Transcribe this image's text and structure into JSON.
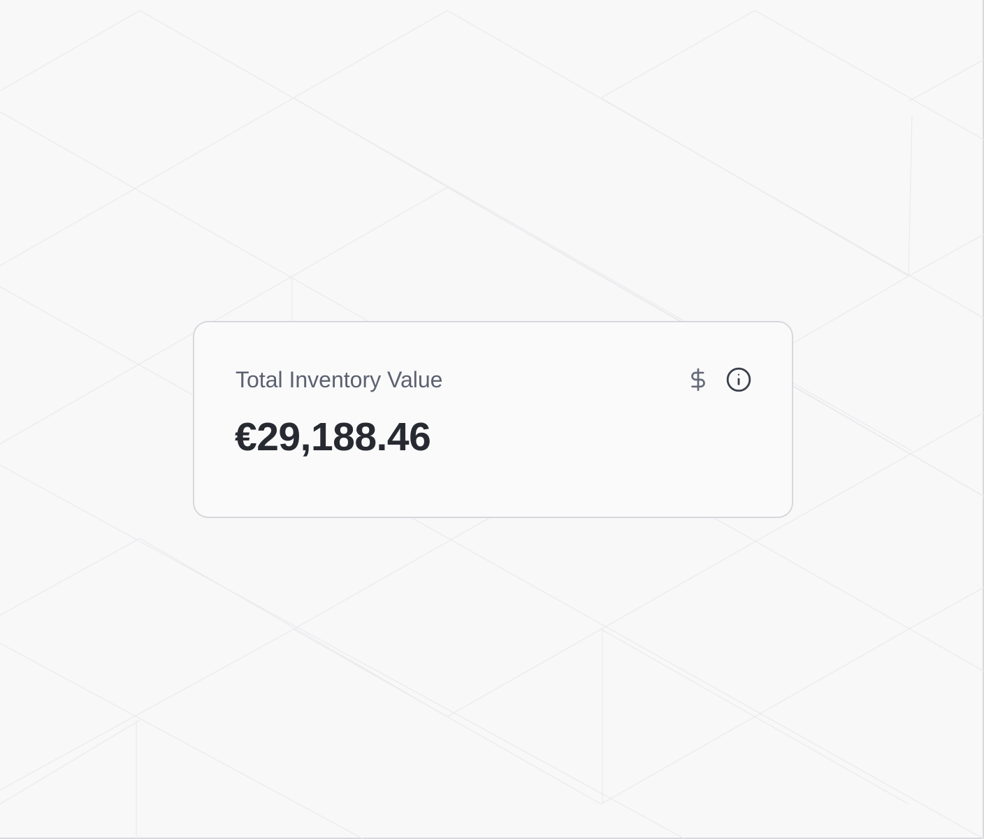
{
  "card": {
    "label": "Total Inventory Value",
    "value": "€29,188.46"
  },
  "icons": {
    "currency": "dollar-sign-icon",
    "info": "info-icon"
  },
  "colors": {
    "background": "#f8f8f9",
    "card_border": "#d6d8dc",
    "label_text": "#5b6170",
    "value_text": "#272a31",
    "pattern_lines": "#e9eaec"
  }
}
